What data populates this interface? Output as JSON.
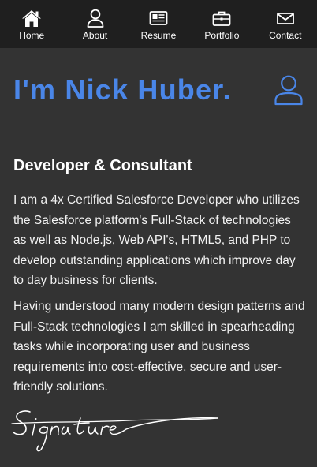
{
  "nav": {
    "items": [
      {
        "label": "Home",
        "icon": "home-icon"
      },
      {
        "label": "About",
        "icon": "user-icon"
      },
      {
        "label": "Resume",
        "icon": "newspaper-icon"
      },
      {
        "label": "Portfolio",
        "icon": "briefcase-icon"
      },
      {
        "label": "Contact",
        "icon": "envelope-icon"
      }
    ],
    "background": "#1f1f1f"
  },
  "hero": {
    "title": "I'm Nick Huber.",
    "title_color": "#4a86e8",
    "icon": "user-icon"
  },
  "about": {
    "subtitle": "Developer & Consultant",
    "paragraphs": [
      "I am a 4x Certified Salesforce Developer who utilizes the Salesforce platform's Full-Stack of technologies as well as Node.js, Web API's, HTML5, and PHP to develop outstanding applications which improve day to day business for clients.",
      "Having understood many modern design patterns and Full-Stack technologies I am skilled in spearheading tasks while incorporating user and business requirements into cost-effective, secure and user-friendly solutions."
    ],
    "signature_text": "Signature"
  },
  "colors": {
    "page_background": "#333333",
    "accent": "#4a86e8"
  }
}
